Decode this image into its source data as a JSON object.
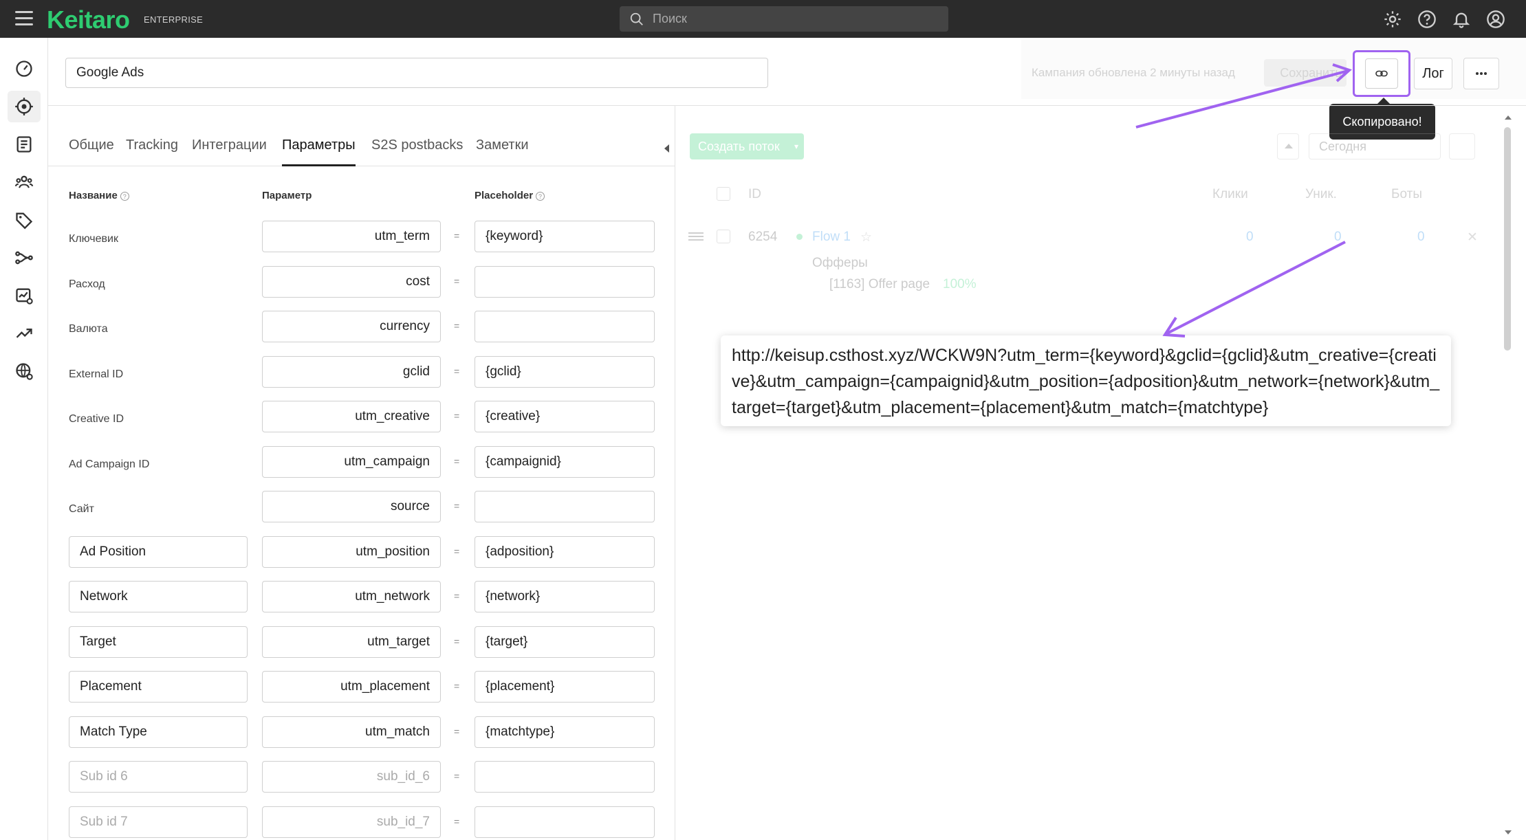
{
  "app": {
    "logo": "Keitaro",
    "edition": "ENTERPRISE",
    "search_placeholder": "Поиск"
  },
  "campaign": {
    "name": "Google Ads",
    "updated_text": "Кампания обновлена 2 минуты назад",
    "save_label": "Сохранить",
    "log_label": "Лог",
    "tooltip": "Скопировано!"
  },
  "tabs": [
    {
      "label": "Общие",
      "active": false
    },
    {
      "label": "Tracking",
      "active": false
    },
    {
      "label": "Интеграции",
      "active": false
    },
    {
      "label": "Параметры",
      "active": true
    },
    {
      "label": "S2S postbacks",
      "active": false
    },
    {
      "label": "Заметки",
      "active": false
    }
  ],
  "columns": {
    "name": "Название",
    "param": "Параметр",
    "placeholder": "Placeholder",
    "equals": "="
  },
  "rows": [
    {
      "name": "Ключевик",
      "editable_name": false,
      "param": "utm_term",
      "placeholder": "{keyword}"
    },
    {
      "name": "Расход",
      "editable_name": false,
      "param": "cost",
      "placeholder": ""
    },
    {
      "name": "Валюта",
      "editable_name": false,
      "param": "currency",
      "placeholder": ""
    },
    {
      "name": "External ID",
      "editable_name": false,
      "param": "gclid",
      "placeholder": "{gclid}"
    },
    {
      "name": "Creative ID",
      "editable_name": false,
      "param": "utm_creative",
      "placeholder": "{creative}"
    },
    {
      "name": "Ad Campaign ID",
      "editable_name": false,
      "param": "utm_campaign",
      "placeholder": "{campaignid}"
    },
    {
      "name": "Сайт",
      "editable_name": false,
      "param": "source",
      "placeholder": ""
    },
    {
      "name": "Ad Position",
      "editable_name": true,
      "param": "utm_position",
      "placeholder": "{adposition}"
    },
    {
      "name": "Network",
      "editable_name": true,
      "param": "utm_network",
      "placeholder": "{network}"
    },
    {
      "name": "Target",
      "editable_name": true,
      "param": "utm_target",
      "placeholder": "{target}"
    },
    {
      "name": "Placement",
      "editable_name": true,
      "param": "utm_placement",
      "placeholder": "{placement}"
    },
    {
      "name": "Match Type",
      "editable_name": true,
      "param": "utm_match",
      "placeholder": "{matchtype}"
    },
    {
      "name": "Sub id 6",
      "editable_name": true,
      "name_is_placeholder": true,
      "param": "sub_id_6",
      "param_is_placeholder": true,
      "placeholder": ""
    },
    {
      "name": "Sub id 7",
      "editable_name": true,
      "name_is_placeholder": true,
      "param": "sub_id_7",
      "param_is_placeholder": true,
      "placeholder": ""
    }
  ],
  "flows": {
    "create_label": "Создать поток",
    "date_label": "Сегодня",
    "headers": {
      "id": "ID",
      "clicks": "Клики",
      "unique": "Уник.",
      "bots": "Боты"
    },
    "row": {
      "id": "6254",
      "name": "Flow 1",
      "clicks": "0",
      "unique": "0",
      "bots": "0",
      "offers_label": "Офферы",
      "offer": "[1163] Offer page",
      "offer_share": "100%"
    }
  },
  "copied_url": "http://keisup.csthost.xyz/WCKW9N?utm_term={keyword}&gclid={gclid}&utm_creative={creative}&utm_campaign={campaignid}&utm_position={adposition}&utm_network={network}&utm_target={target}&utm_placement={placement}&utm_match={matchtype}",
  "colors": {
    "brand": "#2ecc71",
    "annotation": "#a063f0",
    "topbar": "#2b2b2b"
  },
  "icons": {
    "sidebar": [
      "dashboard-icon",
      "campaigns-target-icon",
      "offers-list-icon",
      "users-icon",
      "tags-icon",
      "flows-icon",
      "reports-icon",
      "trends-icon",
      "domains-globe-icon"
    ],
    "top": [
      "settings-gear-icon",
      "help-icon",
      "bell-icon",
      "profile-icon"
    ]
  }
}
